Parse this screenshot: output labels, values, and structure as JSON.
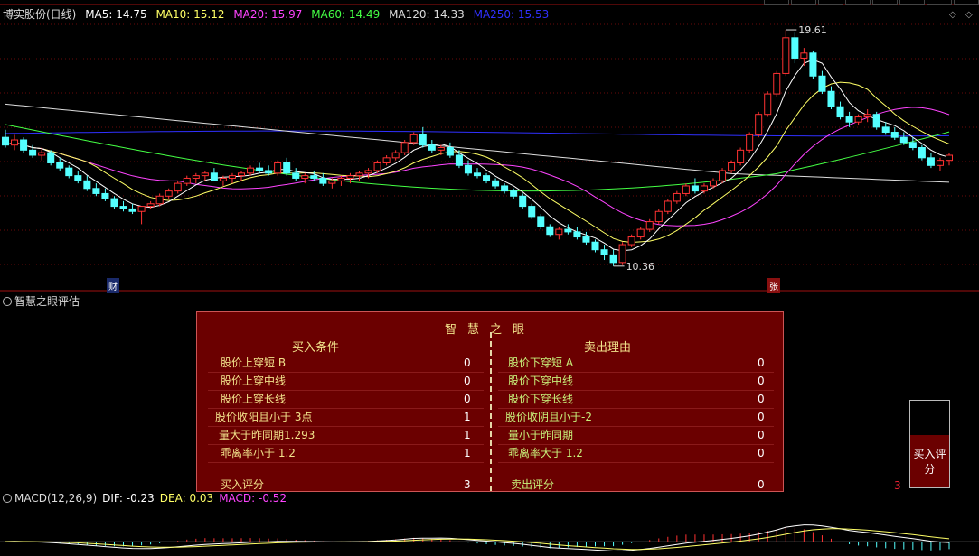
{
  "header": {
    "title": "博实股份(日线)",
    "ma": [
      {
        "label": "MA5: 14.75",
        "color": "#ffffff"
      },
      {
        "label": "MA10: 15.12",
        "color": "#ffff66"
      },
      {
        "label": "MA20: 15.97",
        "color": "#ff44ff"
      },
      {
        "label": "MA60: 14.49",
        "color": "#44ff44"
      },
      {
        "label": "MA120: 14.33",
        "color": "#dddddd"
      },
      {
        "label": "MA250: 15.53",
        "color": "#3030ff"
      }
    ]
  },
  "price": {
    "high_label": "19.61",
    "low_label": "10.36",
    "tag_cai": "财",
    "tag_zhang": "张",
    "candles": [
      [
        15.4,
        15.7,
        15.0,
        15.1
      ],
      [
        15.1,
        15.5,
        14.9,
        15.3
      ],
      [
        15.3,
        15.4,
        14.8,
        14.9
      ],
      [
        14.9,
        15.1,
        14.6,
        14.7
      ],
      [
        14.7,
        15.0,
        14.5,
        14.8
      ],
      [
        14.8,
        14.9,
        14.3,
        14.4
      ],
      [
        14.4,
        14.6,
        14.1,
        14.2
      ],
      [
        14.2,
        14.3,
        13.8,
        13.9
      ],
      [
        13.9,
        14.1,
        13.6,
        13.7
      ],
      [
        13.7,
        13.9,
        13.3,
        13.4
      ],
      [
        13.4,
        13.6,
        13.1,
        13.2
      ],
      [
        13.2,
        13.4,
        12.9,
        13.0
      ],
      [
        13.0,
        13.1,
        12.6,
        12.7
      ],
      [
        12.7,
        12.9,
        12.5,
        12.6
      ],
      [
        12.6,
        12.8,
        12.4,
        12.5
      ],
      [
        12.5,
        12.6,
        12.0,
        12.7
      ],
      [
        12.7,
        12.9,
        12.6,
        12.8
      ],
      [
        12.8,
        13.2,
        12.7,
        13.1
      ],
      [
        13.1,
        13.4,
        13.0,
        13.3
      ],
      [
        13.3,
        13.7,
        13.2,
        13.6
      ],
      [
        13.6,
        13.9,
        13.5,
        13.8
      ],
      [
        13.8,
        14.0,
        13.6,
        13.9
      ],
      [
        13.9,
        14.1,
        13.7,
        14.0
      ],
      [
        14.0,
        14.2,
        13.8,
        13.7
      ],
      [
        13.7,
        13.9,
        13.5,
        13.8
      ],
      [
        13.8,
        14.0,
        13.6,
        13.9
      ],
      [
        13.9,
        14.1,
        13.7,
        14.0
      ],
      [
        14.0,
        14.3,
        13.9,
        14.2
      ],
      [
        14.2,
        14.4,
        14.0,
        14.1
      ],
      [
        14.1,
        14.3,
        13.9,
        14.0
      ],
      [
        14.0,
        14.5,
        13.9,
        14.4
      ],
      [
        14.4,
        14.6,
        13.9,
        14.0
      ],
      [
        14.0,
        14.2,
        13.7,
        13.8
      ],
      [
        13.8,
        14.0,
        13.6,
        13.9
      ],
      [
        13.9,
        14.1,
        13.7,
        13.8
      ],
      [
        13.8,
        14.0,
        13.5,
        13.6
      ],
      [
        13.6,
        13.8,
        13.4,
        13.7
      ],
      [
        13.7,
        13.9,
        13.5,
        13.8
      ],
      [
        13.8,
        14.0,
        13.6,
        13.9
      ],
      [
        13.9,
        14.1,
        13.7,
        14.0
      ],
      [
        14.0,
        14.2,
        13.8,
        14.1
      ],
      [
        14.1,
        14.5,
        14.0,
        14.4
      ],
      [
        14.4,
        14.7,
        14.3,
        14.6
      ],
      [
        14.6,
        14.9,
        14.5,
        14.8
      ],
      [
        14.8,
        15.3,
        14.7,
        15.2
      ],
      [
        15.2,
        15.6,
        15.1,
        15.5
      ],
      [
        15.5,
        15.8,
        15.0,
        15.1
      ],
      [
        15.1,
        15.3,
        14.8,
        14.9
      ],
      [
        14.9,
        15.1,
        14.7,
        15.0
      ],
      [
        15.0,
        15.2,
        14.6,
        14.7
      ],
      [
        14.7,
        14.9,
        14.2,
        14.3
      ],
      [
        14.3,
        14.5,
        13.9,
        14.0
      ],
      [
        14.0,
        14.2,
        13.8,
        13.9
      ],
      [
        13.9,
        14.0,
        13.6,
        13.7
      ],
      [
        13.7,
        13.8,
        13.4,
        13.5
      ],
      [
        13.5,
        13.6,
        13.2,
        13.3
      ],
      [
        13.3,
        13.4,
        13.0,
        13.1
      ],
      [
        13.1,
        13.2,
        12.6,
        12.7
      ],
      [
        12.7,
        12.8,
        12.2,
        12.3
      ],
      [
        12.3,
        12.4,
        11.8,
        11.9
      ],
      [
        11.9,
        12.0,
        11.5,
        11.6
      ],
      [
        11.6,
        11.9,
        11.4,
        11.8
      ],
      [
        11.8,
        12.0,
        11.6,
        11.7
      ],
      [
        11.7,
        11.9,
        11.4,
        11.5
      ],
      [
        11.5,
        11.7,
        11.2,
        11.3
      ],
      [
        11.3,
        11.4,
        10.9,
        11.0
      ],
      [
        11.0,
        11.2,
        10.6,
        10.8
      ],
      [
        10.8,
        11.0,
        10.36,
        10.5
      ],
      [
        10.5,
        11.3,
        10.4,
        11.2
      ],
      [
        11.2,
        11.6,
        11.1,
        11.5
      ],
      [
        11.5,
        11.9,
        11.4,
        11.8
      ],
      [
        11.8,
        12.2,
        11.7,
        12.1
      ],
      [
        12.1,
        12.6,
        12.0,
        12.5
      ],
      [
        12.5,
        13.0,
        12.4,
        12.9
      ],
      [
        12.9,
        13.3,
        12.8,
        13.2
      ],
      [
        13.2,
        13.6,
        13.1,
        13.5
      ],
      [
        13.5,
        13.8,
        13.2,
        13.3
      ],
      [
        13.3,
        13.6,
        13.2,
        13.5
      ],
      [
        13.5,
        13.8,
        13.4,
        13.7
      ],
      [
        13.7,
        14.2,
        13.6,
        14.1
      ],
      [
        14.1,
        14.5,
        14.0,
        14.4
      ],
      [
        14.4,
        15.0,
        14.3,
        14.9
      ],
      [
        14.9,
        15.6,
        14.8,
        15.5
      ],
      [
        15.5,
        16.4,
        15.4,
        16.3
      ],
      [
        16.3,
        17.2,
        16.2,
        17.1
      ],
      [
        17.1,
        18.0,
        17.0,
        17.9
      ],
      [
        17.9,
        19.61,
        17.8,
        19.3
      ],
      [
        19.3,
        19.5,
        18.3,
        18.5
      ],
      [
        18.5,
        18.9,
        18.2,
        18.7
      ],
      [
        18.7,
        18.8,
        17.7,
        17.8
      ],
      [
        17.8,
        18.0,
        17.1,
        17.2
      ],
      [
        17.2,
        17.4,
        16.5,
        16.6
      ],
      [
        16.6,
        16.8,
        16.1,
        16.2
      ],
      [
        16.2,
        16.4,
        15.8,
        16.0
      ],
      [
        16.0,
        16.3,
        15.9,
        16.2
      ],
      [
        16.2,
        16.5,
        16.0,
        16.3
      ],
      [
        16.3,
        16.4,
        15.7,
        15.8
      ],
      [
        15.8,
        16.0,
        15.5,
        15.6
      ],
      [
        15.6,
        15.8,
        15.3,
        15.4
      ],
      [
        15.4,
        15.6,
        15.1,
        15.2
      ],
      [
        15.2,
        15.4,
        14.9,
        15.0
      ],
      [
        15.0,
        15.1,
        14.5,
        14.6
      ],
      [
        14.6,
        14.8,
        14.2,
        14.3
      ],
      [
        14.3,
        14.6,
        14.1,
        14.5
      ],
      [
        14.5,
        14.8,
        14.3,
        14.7
      ]
    ]
  },
  "eval": {
    "panel_label": "智慧之眼评估",
    "title": "智慧之眼",
    "buy_header": "买入条件",
    "sell_header": "卖出理由",
    "buy_rows": [
      {
        "label": "股价上穿短 B",
        "value": "0"
      },
      {
        "label": "股价上穿中线",
        "value": "0"
      },
      {
        "label": "股价上穿长线",
        "value": "0"
      },
      {
        "label": "股价收阳且小于 3点",
        "value": "1"
      },
      {
        "label": "量大于昨同期1.293",
        "value": "1"
      },
      {
        "label": "乖离率小于 1.2",
        "value": "1"
      }
    ],
    "sell_rows": [
      {
        "label": "股价下穿短 A",
        "value": "0"
      },
      {
        "label": "股价下穿中线",
        "value": "0"
      },
      {
        "label": "股价下穿长线",
        "value": "0"
      },
      {
        "label": "股价收阴且小于-2",
        "value": "0"
      },
      {
        "label": "量小于昨同期",
        "value": "0"
      },
      {
        "label": "乖离率大于 1.2",
        "value": "0"
      }
    ],
    "buy_score_label": "买入评分",
    "buy_score": "3",
    "sell_score_label": "卖出评分",
    "sell_score": "0",
    "side_score": "3",
    "side_button": "买入评分"
  },
  "macd": {
    "label": "MACD(12,26,9)",
    "dif": "DIF: -0.23",
    "dea": "DEA: 0.03",
    "macd": "MACD: -0.52",
    "dif_color": "#ffffff",
    "dea_color": "#ffff66",
    "macd_color": "#ff44ff"
  },
  "chart_data": {
    "type": "candlestick",
    "symbol": "博实股份",
    "period": "日线",
    "price_high": 19.61,
    "price_low": 10.36,
    "ma_last": {
      "MA5": 14.75,
      "MA10": 15.12,
      "MA20": 15.97,
      "MA60": 14.49,
      "MA120": 14.33,
      "MA250": 15.53
    },
    "macd_last": {
      "DIF": -0.23,
      "DEA": 0.03,
      "MACD": -0.52
    }
  }
}
